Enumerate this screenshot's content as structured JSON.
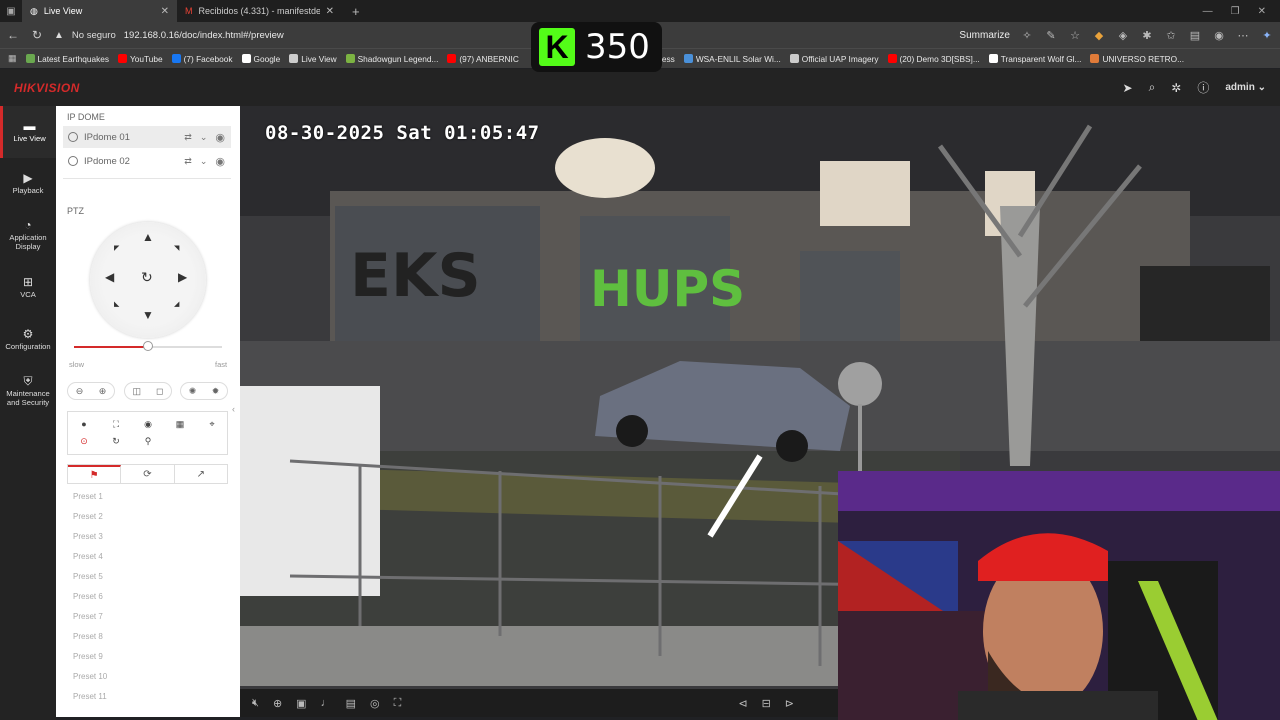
{
  "browser": {
    "tabs": [
      {
        "title": "Live View",
        "active": true
      },
      {
        "title": "Recibidos (4.331) - manifestdesig",
        "active": false
      }
    ],
    "new_tab": "+",
    "security": "No seguro",
    "url": "192.168.0.16/doc/index.html#/preview",
    "summarize": "Summarize",
    "bookmarks": [
      {
        "label": "Latest Earthquakes",
        "color": "#6aa84f"
      },
      {
        "label": "YouTube",
        "color": "#ff0000"
      },
      {
        "label": "(7) Facebook",
        "color": "#1877f2"
      },
      {
        "label": "Google",
        "color": "#ffffff"
      },
      {
        "label": "Live View",
        "color": "#cccccc"
      },
      {
        "label": "Shadowgun Legend...",
        "color": "#7cb342"
      },
      {
        "label": "(97) ANBERNIC",
        "color": "#ff0000"
      },
      {
        "label": "Stripe Express",
        "color": "#635bff"
      },
      {
        "label": "WSA-ENLIL Solar Wi...",
        "color": "#4a90d9"
      },
      {
        "label": "Official UAP Imagery",
        "color": "#cccccc"
      },
      {
        "label": "(20) Demo 3D[SBS]...",
        "color": "#ff0000"
      },
      {
        "label": "Transparent Wolf Gl...",
        "color": "#ffffff"
      },
      {
        "label": "UNIVERSO RETRO...",
        "color": "#e07b39"
      }
    ]
  },
  "overlay": {
    "letter": "K",
    "count": "350"
  },
  "hik": {
    "logo": "HIKVISION",
    "user": "admin",
    "nav": [
      {
        "label": "Live View",
        "icon": "monitor-icon",
        "glyph": "▬"
      },
      {
        "label": "Playback",
        "icon": "playback-icon",
        "glyph": "▶"
      },
      {
        "label": "Application Display",
        "icon": "application-icon",
        "glyph": "◔"
      },
      {
        "label": "VCA",
        "icon": "vca-icon",
        "glyph": "⊞"
      },
      {
        "label": "Configuration",
        "icon": "gear-icon",
        "glyph": "⚙"
      },
      {
        "label": "Maintenance and Security",
        "icon": "maintenance-icon",
        "glyph": "⛨"
      }
    ]
  },
  "panel": {
    "group_title": "IP DOME",
    "cameras": [
      "IPdome 01",
      "IPdome 02"
    ],
    "ptz_title": "PTZ",
    "speed_slow": "slow",
    "speed_fast": "fast",
    "speed_fraction": 0.5,
    "presets": [
      "Preset 1",
      "Preset 2",
      "Preset 3",
      "Preset 4",
      "Preset 5",
      "Preset 6",
      "Preset 7",
      "Preset 8",
      "Preset 9",
      "Preset 10",
      "Preset 11"
    ]
  },
  "video": {
    "timestamp": "08-30-2025 Sat 01:05:47"
  },
  "colors": {
    "accent": "#d42a2a",
    "kick": "#53fc18"
  }
}
